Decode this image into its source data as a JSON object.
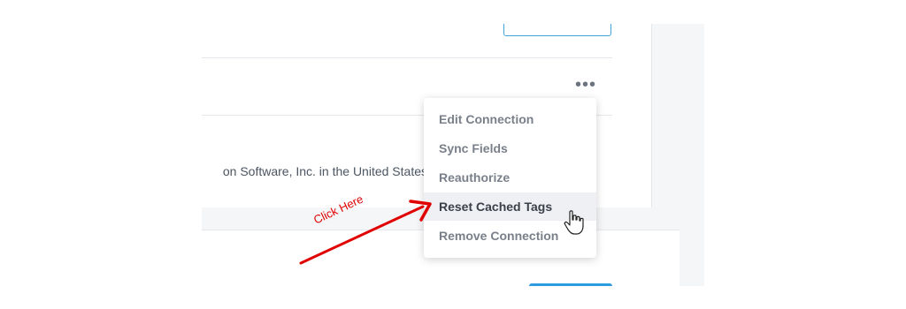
{
  "card_top": {
    "truncated_text": "on Software, Inc. in the United States"
  },
  "connection_menu": {
    "items": [
      {
        "label": "Edit Connection"
      },
      {
        "label": "Sync Fields"
      },
      {
        "label": "Reauthorize"
      },
      {
        "label": "Reset Cached Tags"
      },
      {
        "label": "Remove Connection"
      }
    ],
    "highlighted_item": "Reset Cached Tags"
  },
  "annotation": {
    "label": "Click Here",
    "color": "#e00000"
  },
  "icons": {
    "more": "more-horizontal-icon",
    "cursor": "hand-pointer-icon",
    "arrow": "red-arrow-icon"
  }
}
